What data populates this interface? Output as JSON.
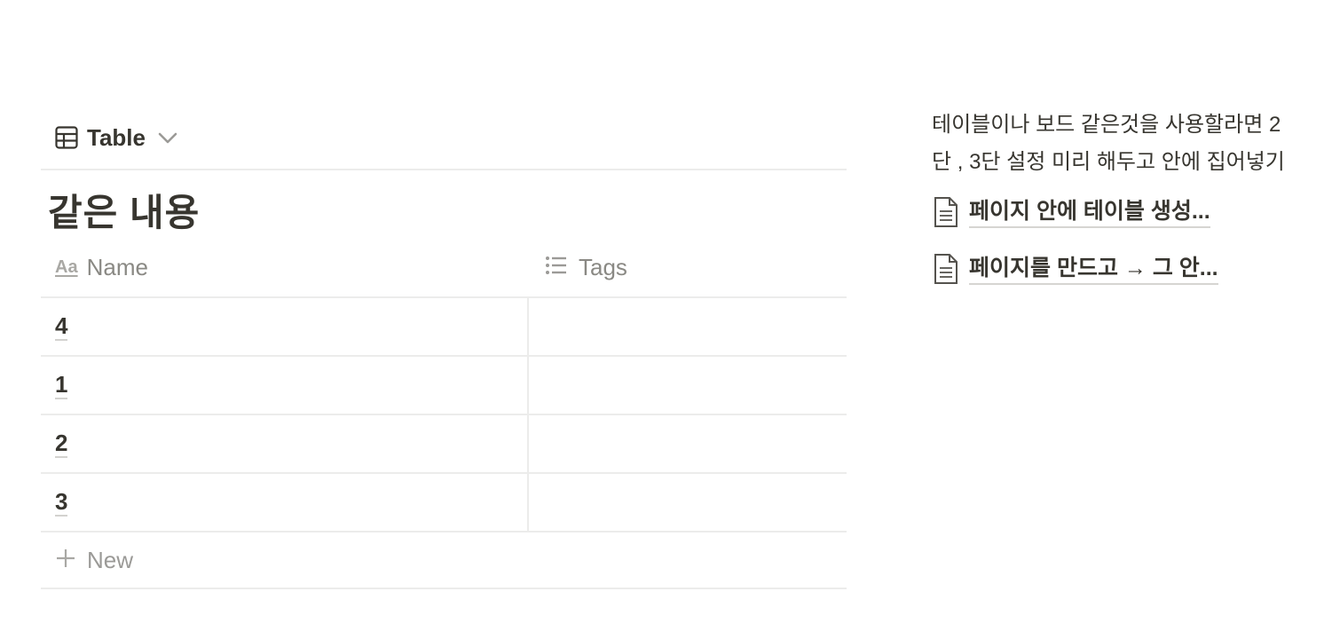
{
  "view": {
    "label": "Table",
    "icon": "table-icon",
    "dropdown_icon": "chevron-down-icon"
  },
  "database": {
    "title": "같은 내용",
    "columns": [
      {
        "label": "Name",
        "icon": "text-property-icon",
        "icon_glyph": "Aa"
      },
      {
        "label": "Tags",
        "icon": "list-icon"
      }
    ],
    "rows": [
      {
        "name": "4",
        "tags": ""
      },
      {
        "name": "1",
        "tags": ""
      },
      {
        "name": "2",
        "tags": ""
      },
      {
        "name": "3",
        "tags": ""
      }
    ],
    "new_label": "New"
  },
  "sidebar": {
    "text": "테이블이나 보드 같은것을 사용할라면 2단 , 3단 설정 미리 해두고 안에 집어넣기",
    "links": [
      {
        "label": "페이지 안에 테이블 생성...",
        "icon": "page-icon"
      },
      {
        "label": "페이지를 만드고 → 그 안...",
        "icon": "page-icon"
      }
    ]
  },
  "colors": {
    "text": "#37352f",
    "muted": "#8a8984",
    "border": "#ececeb"
  }
}
